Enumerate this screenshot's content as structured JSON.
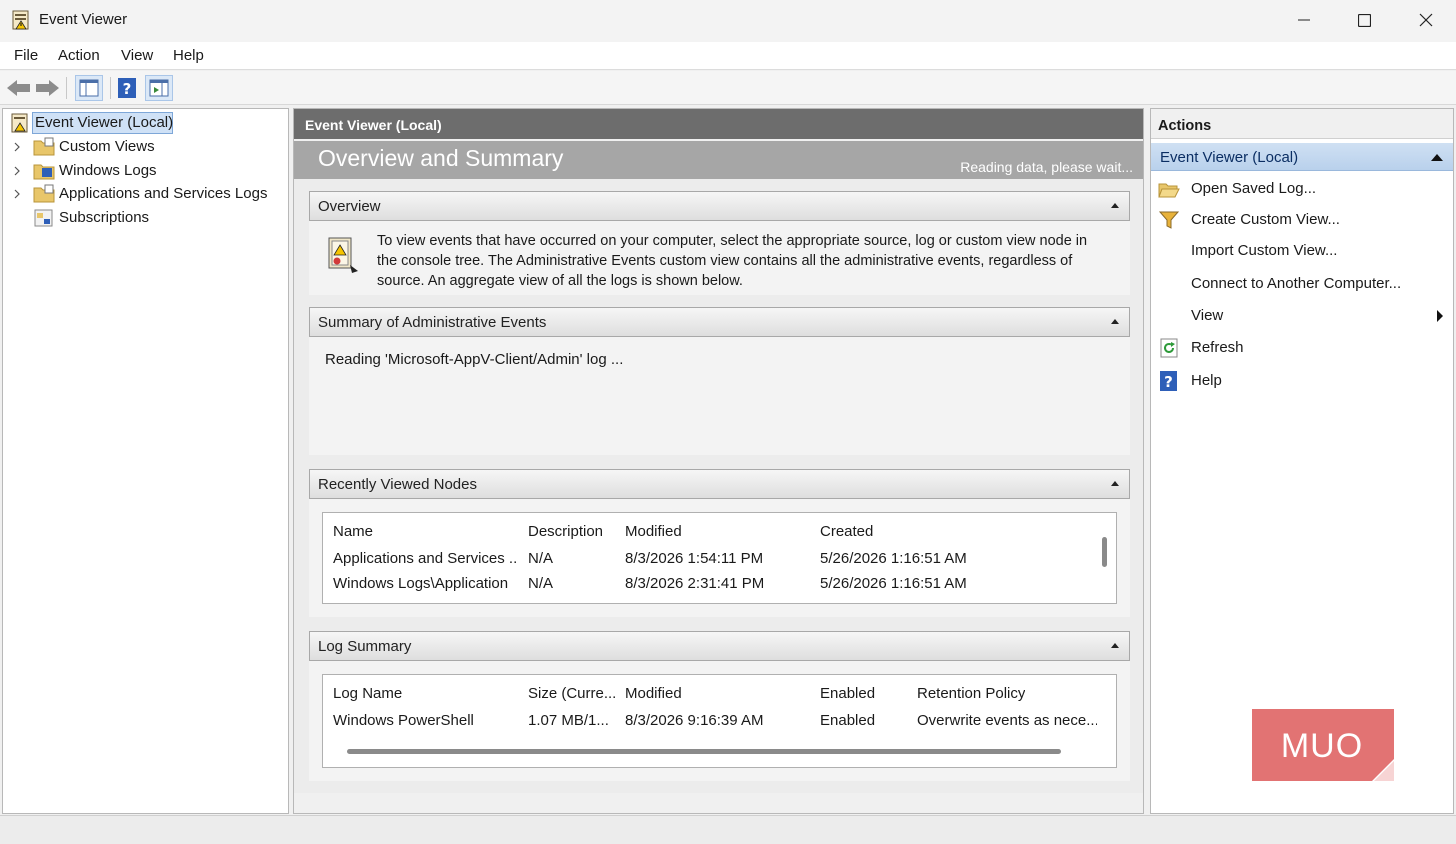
{
  "window": {
    "title": "Event Viewer"
  },
  "menu": [
    "File",
    "Action",
    "View",
    "Help"
  ],
  "tree": {
    "root": "Event Viewer (Local)",
    "items": [
      {
        "label": "Custom Views",
        "icon": "folder-icon"
      },
      {
        "label": "Windows Logs",
        "icon": "folder-log-icon"
      },
      {
        "label": "Applications and Services Logs",
        "icon": "folder-icon"
      },
      {
        "label": "Subscriptions",
        "icon": "subscriptions-icon"
      }
    ]
  },
  "center": {
    "header": "Event Viewer (Local)",
    "overview_title": "Overview and Summary",
    "status": "Reading data, please wait...",
    "sections": {
      "overview": {
        "title": "Overview",
        "text": "To view events that have occurred on your computer, select the appropriate source, log or custom view node in the console tree. The Administrative Events custom view contains all the administrative events, regardless of source. An aggregate view of all the logs is shown below."
      },
      "summary": {
        "title": "Summary of Administrative Events",
        "reading": "Reading 'Microsoft-AppV-Client/Admin' log ..."
      },
      "recent": {
        "title": "Recently Viewed Nodes",
        "columns": [
          "Name",
          "Description",
          "Modified",
          "Created"
        ],
        "rows": [
          [
            "Applications and Services ...",
            "N/A",
            "8/3/2026 1:54:11 PM",
            "5/26/2026 1:16:51 AM"
          ],
          [
            "Windows Logs\\Application",
            "N/A",
            "8/3/2026 2:31:41 PM",
            "5/26/2026 1:16:51 AM"
          ]
        ]
      },
      "log_summary": {
        "title": "Log Summary",
        "columns": [
          "Log Name",
          "Size (Curre...",
          "Modified",
          "Enabled",
          "Retention Policy"
        ],
        "rows": [
          [
            "Windows PowerShell",
            "1.07 MB/1...",
            "8/3/2026 9:16:39 AM",
            "Enabled",
            "Overwrite events as nece..."
          ]
        ]
      }
    }
  },
  "actions": {
    "header": "Actions",
    "group": "Event Viewer (Local)",
    "items": [
      {
        "label": "Open Saved Log...",
        "icon": "open-folder-icon"
      },
      {
        "label": "Create Custom View...",
        "icon": "filter-icon"
      },
      {
        "label": "Import Custom View...",
        "icon": ""
      },
      {
        "label": "Connect to Another Computer...",
        "icon": ""
      },
      {
        "label": "View",
        "icon": "",
        "submenu": true
      },
      {
        "label": "Refresh",
        "icon": "refresh-icon"
      },
      {
        "label": "Help",
        "icon": "help-icon"
      }
    ]
  },
  "watermark": {
    "text": "MUO",
    "color": "#e27373"
  },
  "colors": {
    "accent": "#cfe1f6",
    "header_bg": "#6d6d6d",
    "band_bg": "#a6a6a6"
  }
}
